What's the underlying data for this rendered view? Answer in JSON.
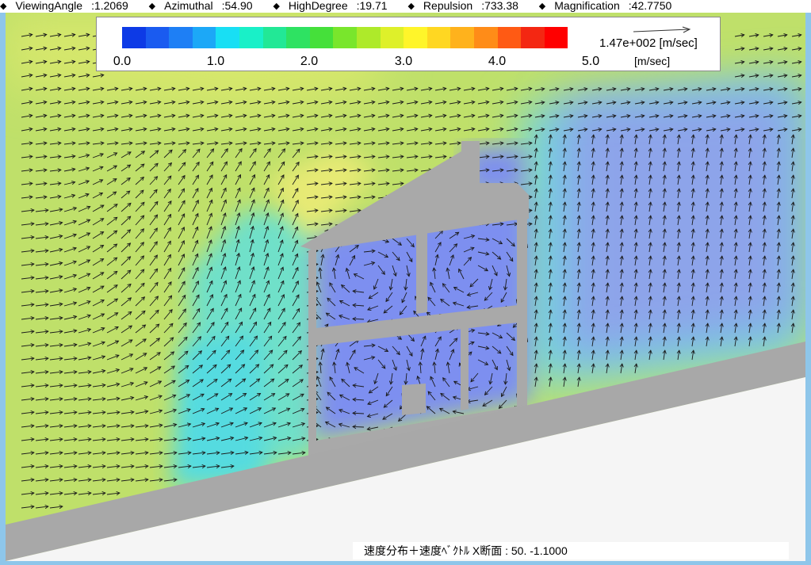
{
  "status": {
    "items": [
      {
        "label": "ViewingAngle",
        "value": ":1.2069"
      },
      {
        "label": "Azimuthal",
        "value": ":54.90"
      },
      {
        "label": "HighDegree",
        "value": ":19.71"
      },
      {
        "label": "Repulsion",
        "value": ":733.38"
      },
      {
        "label": "Magnification",
        "value": ":42.7750"
      }
    ]
  },
  "legend": {
    "scale_colors": [
      "#0d3ae6",
      "#1a5bf0",
      "#1e7ff5",
      "#1ca8f7",
      "#18dff4",
      "#19f0c8",
      "#22e896",
      "#2ee262",
      "#45e03a",
      "#79e62c",
      "#aeea2a",
      "#def02a",
      "#fff52a",
      "#ffd722",
      "#ffb21c",
      "#ff8c18",
      "#ff5a14",
      "#f42712",
      "#ff0000"
    ],
    "ticks": [
      "0.0",
      "1.0",
      "2.0",
      "3.0",
      "4.0",
      "5.0"
    ],
    "ref_value": "1.47e+002",
    "ref_unit": "[m/sec]",
    "unit": "[m/sec]"
  },
  "caption": "速度分布＋速度ﾍﾞｸﾄﾙ X断面 : 50.  -1.1000",
  "colors": {
    "far_field": "#bfe06a",
    "low_speed": "#7f94ea",
    "mid_speed": "#66e0da",
    "building": "#a9a9a9",
    "ground": "#a8a8a8",
    "frame": "#8ec6ea"
  }
}
